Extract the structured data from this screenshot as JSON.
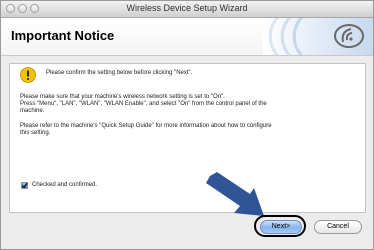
{
  "window": {
    "title": "Wireless Device Setup Wizard"
  },
  "header": {
    "title": "Important Notice"
  },
  "notice": {
    "confirm_text": "Please confirm the setting below before clicking \"Next\".",
    "para1_line1": "Please make sure that your machine's wireless network setting is set to \"On\".",
    "para1_line2": "Press \"Menu\", \"LAN\", \"WLAN\", \"WLAN Enable\", and select \"On\" from the control panel of the",
    "para1_line3": "machine.",
    "para2_line1": "Please refer to the machine's \"Quick Setup Guide\" for more information about how to configure",
    "para2_line2": "this setting."
  },
  "confirm_checkbox": {
    "label": "Checked and confirmed.",
    "checked": true
  },
  "buttons": {
    "next": "Next>",
    "cancel": "Cancel"
  },
  "colors": {
    "arrow": "#2f5597",
    "warning": "#f2c200",
    "accent": "#3f73c6"
  }
}
